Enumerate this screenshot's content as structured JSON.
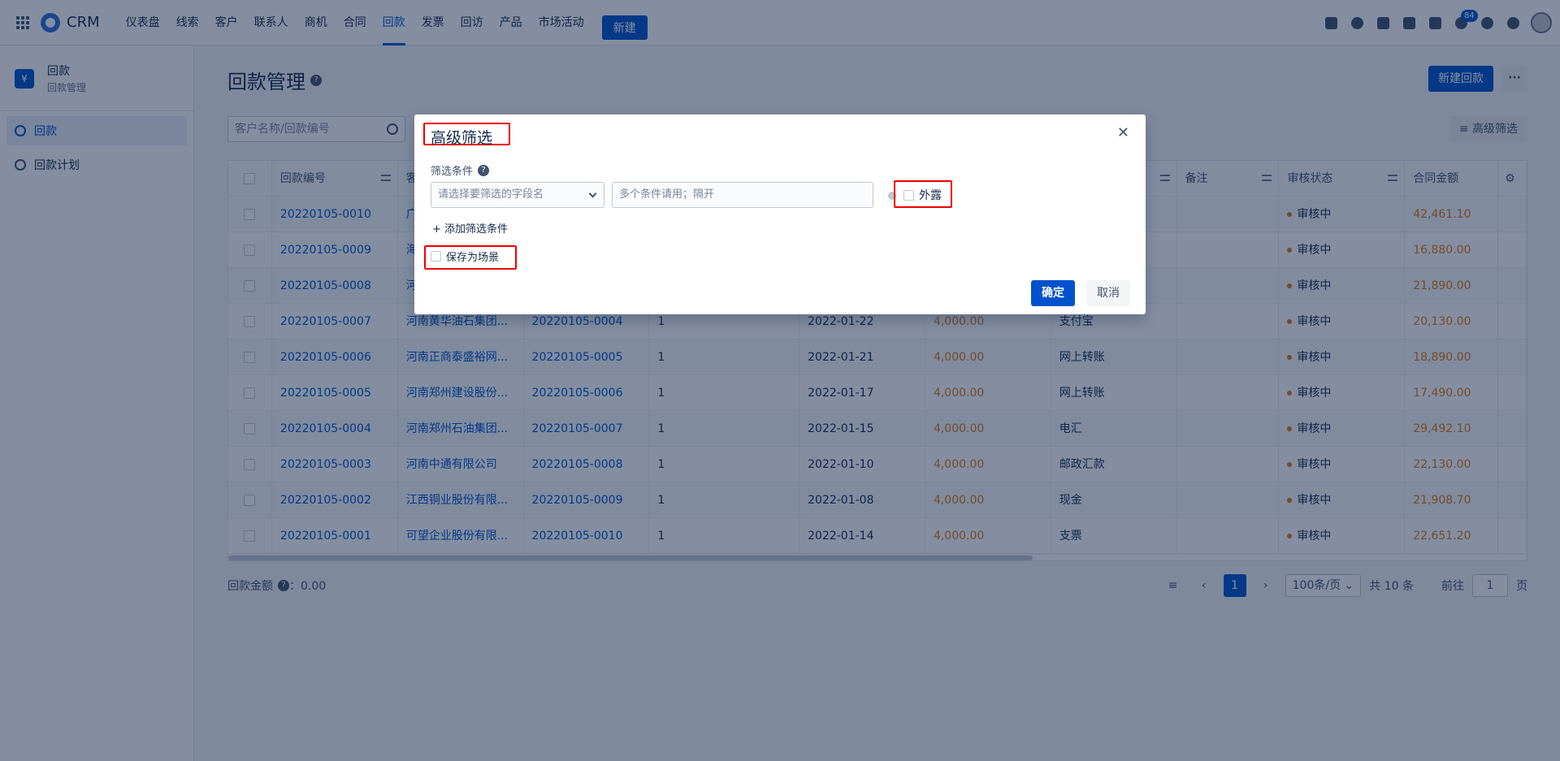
{
  "app": {
    "name": "CRM"
  },
  "nav": {
    "items": [
      "仪表盘",
      "线索",
      "客户",
      "联系人",
      "商机",
      "合同",
      "回款",
      "发票",
      "回访",
      "产品",
      "市场活动"
    ],
    "active": "回款",
    "new_label": "新建"
  },
  "topbar": {
    "notification_count": "84"
  },
  "sidebar": {
    "title": "回款",
    "subtitle": "回款管理",
    "items": [
      {
        "label": "回款",
        "active": true
      },
      {
        "label": "回款计划",
        "active": false
      }
    ]
  },
  "page": {
    "title": "回款管理",
    "new_button": "新建回款",
    "more_button": "···",
    "search_placeholder": "客户名称/回款编号",
    "advanced_filter": "高级筛选"
  },
  "table": {
    "columns": [
      "回款编号",
      "客",
      "",
      "",
      "",
      "",
      "",
      "",
      "备注",
      "审核状态",
      "合同金额"
    ],
    "rows": [
      {
        "id": "20220105-0010",
        "customer": "广",
        "contract": "",
        "period": "",
        "date": "",
        "amount": "",
        "method": "",
        "note": "",
        "status": "审核中",
        "contract_amount": "42,461.10"
      },
      {
        "id": "20220105-0009",
        "customer": "海",
        "contract": "",
        "period": "",
        "date": "",
        "amount": "",
        "method": "",
        "note": "",
        "status": "审核中",
        "contract_amount": "16,880.00"
      },
      {
        "id": "20220105-0008",
        "customer": "河",
        "contract": "",
        "period": "",
        "date": "",
        "amount": "",
        "method": "",
        "note": "",
        "status": "审核中",
        "contract_amount": "21,890.00"
      },
      {
        "id": "20220105-0007",
        "customer": "河南黄华油石集团...",
        "contract": "20220105-0004",
        "period": "1",
        "date": "2022-01-22",
        "amount": "4,000.00",
        "method": "支付宝",
        "note": "",
        "status": "审核中",
        "contract_amount": "20,130.00"
      },
      {
        "id": "20220105-0006",
        "customer": "河南正商泰盛裕网...",
        "contract": "20220105-0005",
        "period": "1",
        "date": "2022-01-21",
        "amount": "4,000.00",
        "method": "网上转账",
        "note": "",
        "status": "审核中",
        "contract_amount": "18,890.00"
      },
      {
        "id": "20220105-0005",
        "customer": "河南郑州建设股份...",
        "contract": "20220105-0006",
        "period": "1",
        "date": "2022-01-17",
        "amount": "4,000.00",
        "method": "网上转账",
        "note": "",
        "status": "审核中",
        "contract_amount": "17,490.00"
      },
      {
        "id": "20220105-0004",
        "customer": "河南郑州石油集团...",
        "contract": "20220105-0007",
        "period": "1",
        "date": "2022-01-15",
        "amount": "4,000.00",
        "method": "电汇",
        "note": "",
        "status": "审核中",
        "contract_amount": "29,492.10"
      },
      {
        "id": "20220105-0003",
        "customer": "河南中通有限公司",
        "contract": "20220105-0008",
        "period": "1",
        "date": "2022-01-10",
        "amount": "4,000.00",
        "method": "邮政汇款",
        "note": "",
        "status": "审核中",
        "contract_amount": "22,130.00"
      },
      {
        "id": "20220105-0002",
        "customer": "江西铜业股份有限...",
        "contract": "20220105-0009",
        "period": "1",
        "date": "2022-01-08",
        "amount": "4,000.00",
        "method": "现金",
        "note": "",
        "status": "审核中",
        "contract_amount": "21,908.70"
      },
      {
        "id": "20220105-0001",
        "customer": "可望企业股份有限...",
        "contract": "20220105-0010",
        "period": "1",
        "date": "2022-01-14",
        "amount": "4,000.00",
        "method": "支票",
        "note": "",
        "status": "审核中",
        "contract_amount": "22,651.20"
      }
    ]
  },
  "footer": {
    "total_label": "回款金额",
    "total_value": "：0.00",
    "current_page": "1",
    "page_size": "100条/页",
    "total_count": "共 10 条",
    "goto_prefix": "前往",
    "goto_value": "1",
    "goto_suffix": "页"
  },
  "modal": {
    "title": "高级筛选",
    "condition_label": "筛选条件",
    "field_placeholder": "请选择要筛选的字段名",
    "value_placeholder": "多个条件请用；隔开",
    "expose_label": "外露",
    "add_condition": "+ 添加筛选条件",
    "save_scene": "保存为场景",
    "confirm": "确定",
    "cancel": "取消"
  },
  "colors": {
    "primary": "#0052cc",
    "amount": "#de7a12",
    "highlight": "#e00000"
  }
}
